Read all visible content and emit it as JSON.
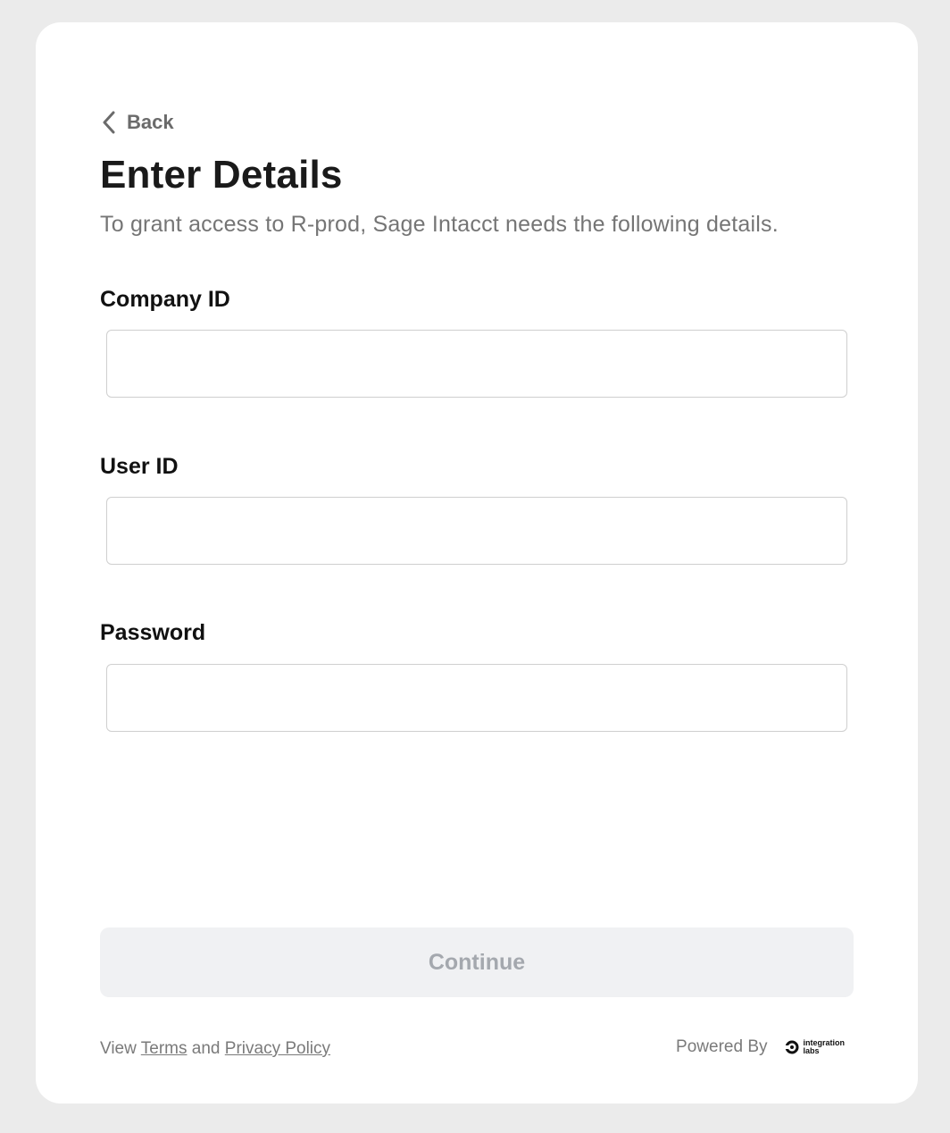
{
  "header": {
    "back_label": "Back",
    "title": "Enter Details",
    "subtitle": "To grant access to R-prod, Sage Intacct needs the following details."
  },
  "form": {
    "fields": [
      {
        "label": "Company ID",
        "value": "",
        "placeholder": ""
      },
      {
        "label": "User ID",
        "value": "",
        "placeholder": ""
      },
      {
        "label": "Password",
        "value": "",
        "placeholder": ""
      }
    ],
    "submit_label": "Continue"
  },
  "footer": {
    "view_text": "View",
    "terms_label": "Terms",
    "and_text": "and",
    "privacy_label": "Privacy Policy",
    "powered_by": "Powered By",
    "logo_line1": "integration",
    "logo_line2": "labs"
  },
  "icons": {
    "back": "chevron-left-icon",
    "logo": "integration-labs-logo-icon"
  },
  "colors": {
    "page_background": "#ebebeb",
    "card_background": "#ffffff",
    "button_disabled_bg": "#f0f1f3",
    "button_disabled_text": "#a4a8ae"
  }
}
